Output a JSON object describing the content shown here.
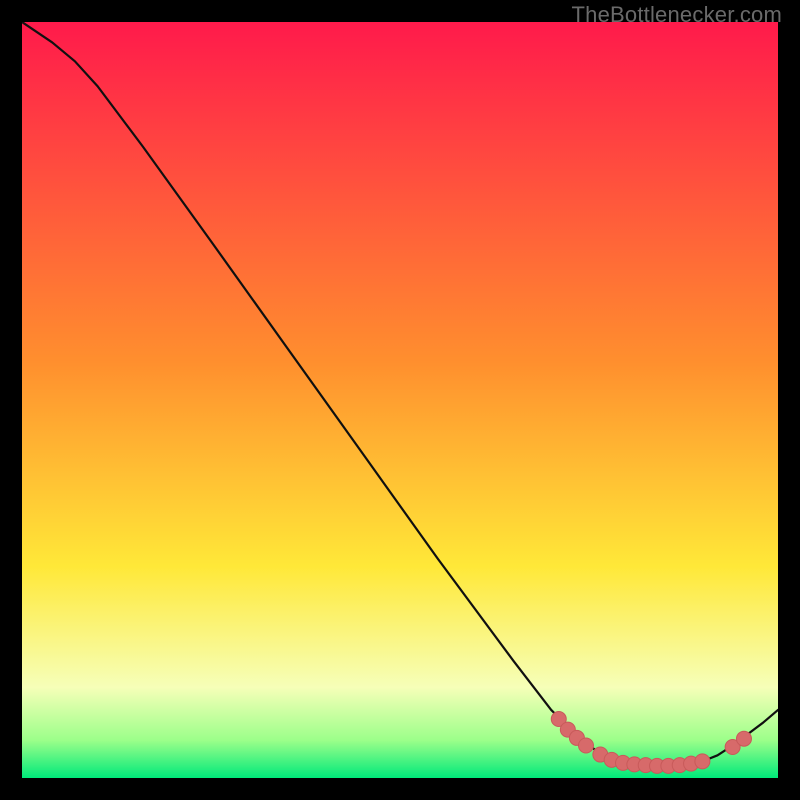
{
  "brand": {
    "label": "TheBottlenecker.com"
  },
  "colors": {
    "black": "#000000",
    "curve": "#101010",
    "dot_fill": "#d76a6a",
    "dot_stroke": "#c85a5a",
    "grad_top": "#ff1a4b",
    "grad_orange": "#ff8f2e",
    "grad_yellow": "#ffe838",
    "grad_pale": "#f6ffb8",
    "grad_green1": "#9cff8a",
    "grad_green2": "#00e97a"
  },
  "chart_data": {
    "type": "line",
    "title": "",
    "xlabel": "",
    "ylabel": "",
    "xlim": [
      0,
      100
    ],
    "ylim": [
      0,
      100
    ],
    "curve": [
      {
        "x": 0,
        "y": 100
      },
      {
        "x": 4,
        "y": 97.3
      },
      {
        "x": 7,
        "y": 94.8
      },
      {
        "x": 10,
        "y": 91.5
      },
      {
        "x": 16,
        "y": 83.5
      },
      {
        "x": 25,
        "y": 71.0
      },
      {
        "x": 35,
        "y": 57.0
      },
      {
        "x": 45,
        "y": 43.0
      },
      {
        "x": 55,
        "y": 29.0
      },
      {
        "x": 65,
        "y": 15.5
      },
      {
        "x": 70,
        "y": 9.0
      },
      {
        "x": 74,
        "y": 5.0
      },
      {
        "x": 76,
        "y": 3.6
      },
      {
        "x": 78,
        "y": 2.6
      },
      {
        "x": 80,
        "y": 2.0
      },
      {
        "x": 82,
        "y": 1.7
      },
      {
        "x": 84,
        "y": 1.6
      },
      {
        "x": 86,
        "y": 1.6
      },
      {
        "x": 88,
        "y": 1.8
      },
      {
        "x": 90,
        "y": 2.2
      },
      {
        "x": 92,
        "y": 3.0
      },
      {
        "x": 94,
        "y": 4.3
      },
      {
        "x": 96,
        "y": 5.8
      },
      {
        "x": 98,
        "y": 7.3
      },
      {
        "x": 100,
        "y": 9.0
      }
    ],
    "dots": [
      {
        "x": 71.0,
        "y": 7.8
      },
      {
        "x": 72.2,
        "y": 6.4
      },
      {
        "x": 73.4,
        "y": 5.3
      },
      {
        "x": 74.6,
        "y": 4.3
      },
      {
        "x": 76.5,
        "y": 3.1
      },
      {
        "x": 78.0,
        "y": 2.4
      },
      {
        "x": 79.5,
        "y": 2.0
      },
      {
        "x": 81.0,
        "y": 1.8
      },
      {
        "x": 82.5,
        "y": 1.7
      },
      {
        "x": 84.0,
        "y": 1.6
      },
      {
        "x": 85.5,
        "y": 1.6
      },
      {
        "x": 87.0,
        "y": 1.7
      },
      {
        "x": 88.5,
        "y": 1.9
      },
      {
        "x": 90.0,
        "y": 2.2
      },
      {
        "x": 94.0,
        "y": 4.1
      },
      {
        "x": 95.5,
        "y": 5.2
      }
    ],
    "dot_radius": 7.5
  }
}
